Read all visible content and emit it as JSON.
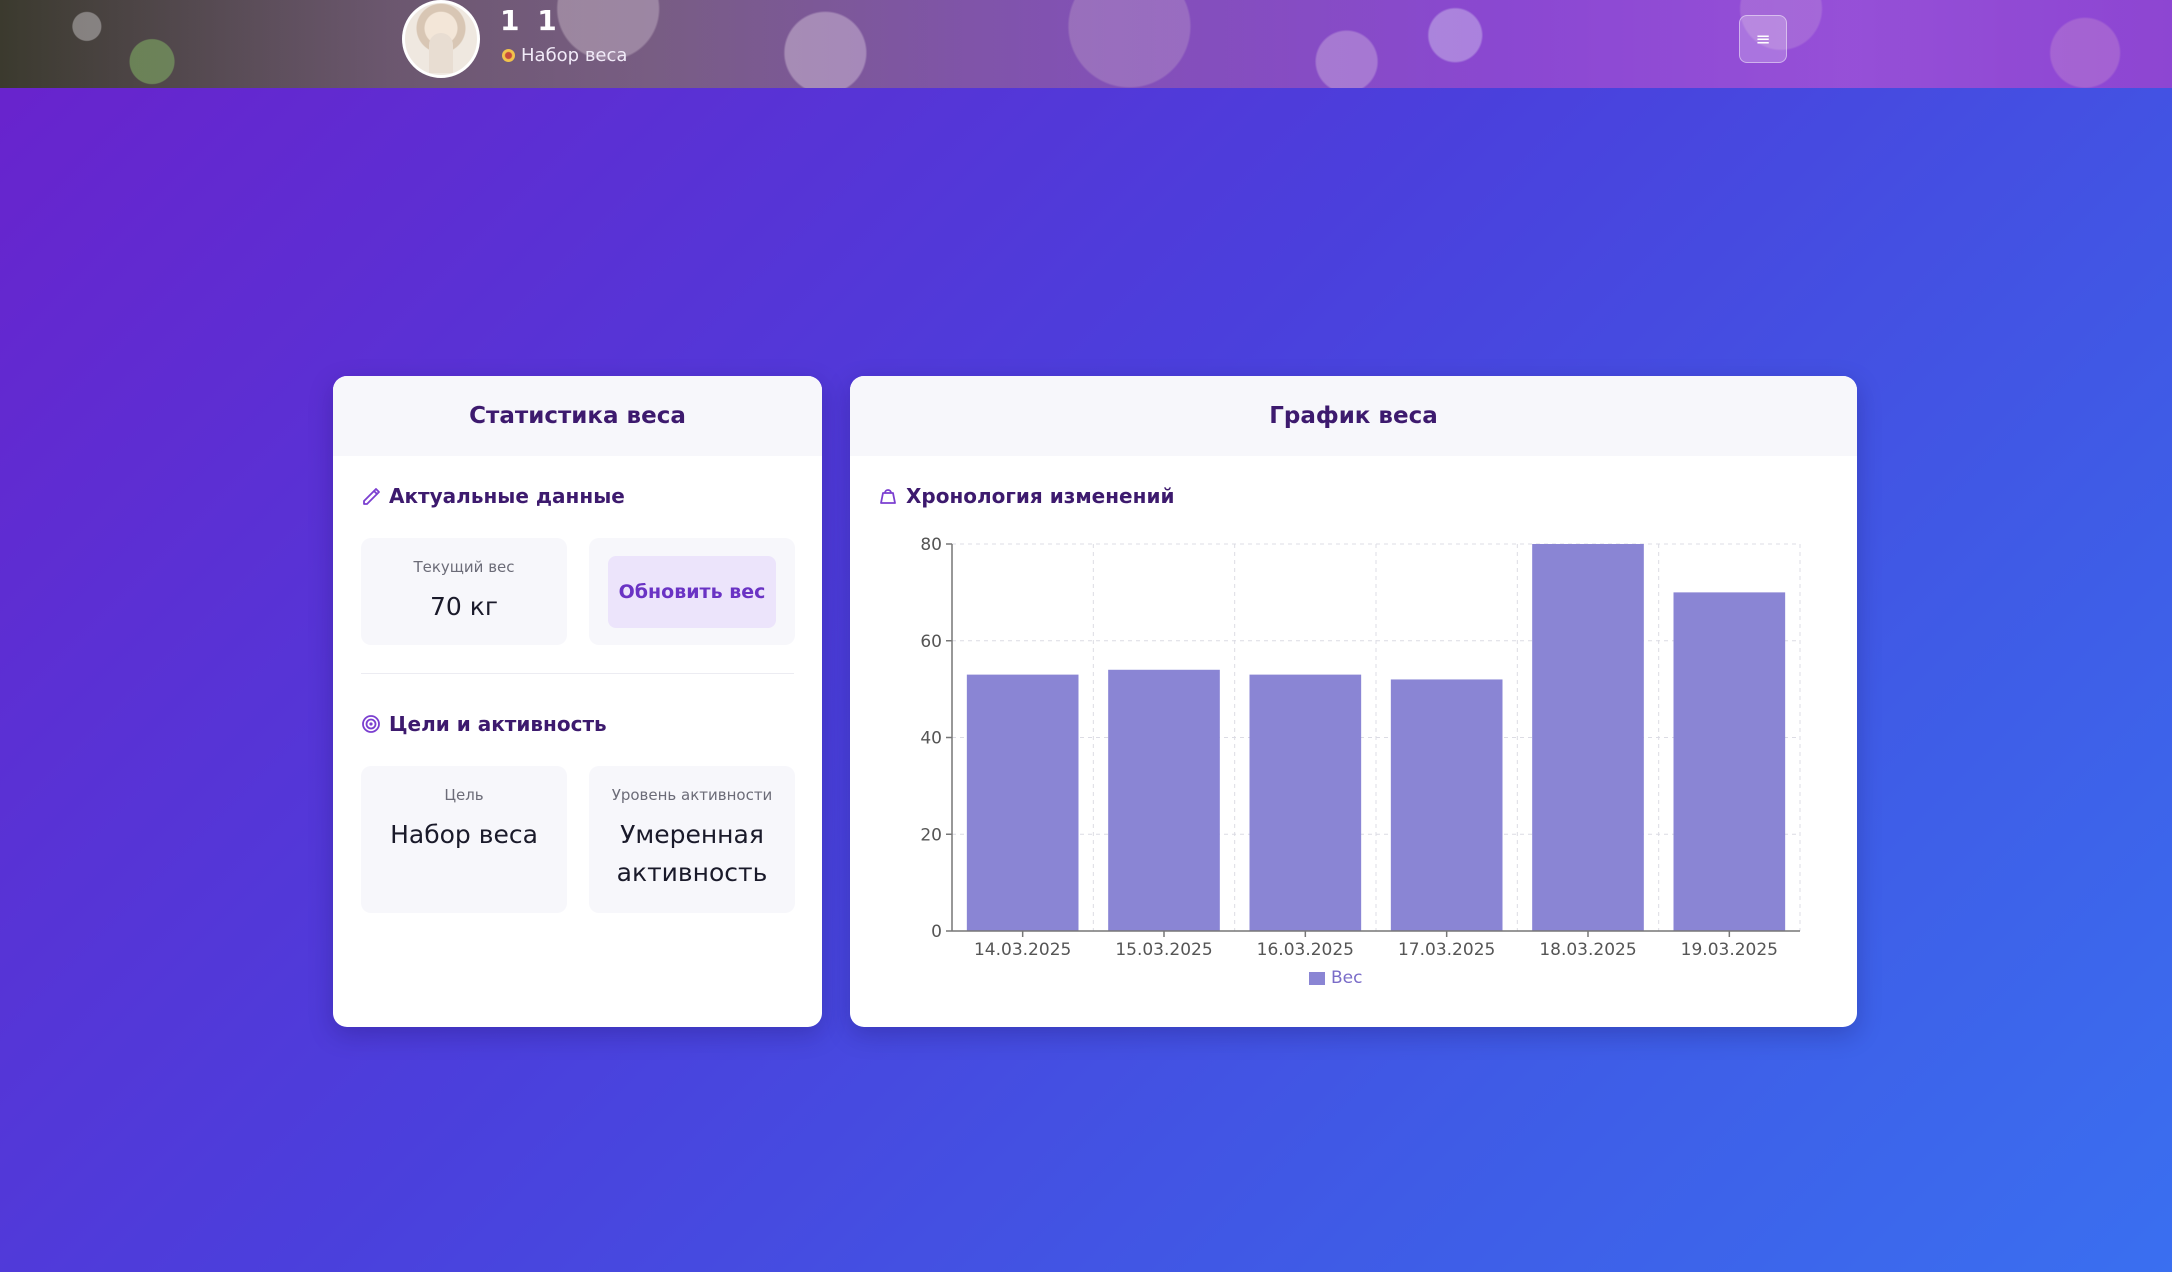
{
  "header": {
    "user_name": "1 1",
    "user_goal": "Набор веса",
    "menu_icon": "≡"
  },
  "stats_card": {
    "title": "Статистика веса",
    "current_section_title": "Актуальные данные",
    "current_weight_label": "Текущий вес",
    "current_weight_value": "70 кг",
    "update_button_label": "Обновить вес",
    "goals_section_title": "Цели и активность",
    "goal_label": "Цель",
    "goal_value": "Набор веса",
    "activity_label": "Уровень активности",
    "activity_value": "Умеренная активность"
  },
  "chart_card": {
    "title": "График веса",
    "section_title": "Хронология изменений"
  },
  "colors": {
    "bar": "#8a85d4",
    "title": "#3d1a6e",
    "accent": "#6a33c4"
  },
  "chart_data": {
    "type": "bar",
    "categories": [
      "14.03.2025",
      "15.03.2025",
      "16.03.2025",
      "17.03.2025",
      "18.03.2025",
      "19.03.2025"
    ],
    "series": [
      {
        "name": "Вес",
        "values": [
          53,
          54,
          53,
          52,
          80,
          70
        ]
      }
    ],
    "ylim": [
      0,
      80
    ],
    "yticks": [
      0,
      20,
      40,
      60,
      80
    ],
    "grid": true,
    "legend": "bottom"
  }
}
